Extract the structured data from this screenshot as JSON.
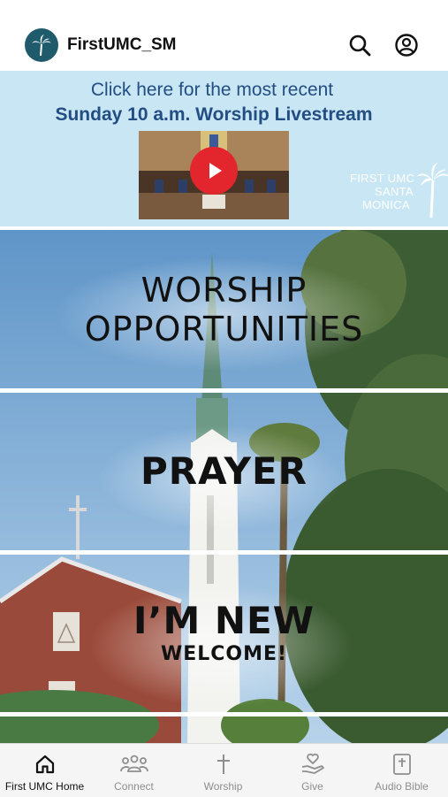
{
  "header": {
    "app_title": "FirstUMC_SM",
    "search_icon": "search-icon",
    "profile_icon": "account-circle-icon"
  },
  "banner": {
    "line1": "Click here for the most recent",
    "line2": "Sunday 10 a.m. Worship Livestream",
    "video_icon": "play-icon",
    "brand_line1": "FIRST UMC",
    "brand_line2": "SANTA",
    "brand_line3": "MONICA",
    "bg_color": "#c9e6f4",
    "text_color": "#234e84",
    "play_color": "#e3262e"
  },
  "tiles": [
    {
      "title": "WORSHIP",
      "title2": "OPPORTUNITIES"
    },
    {
      "title": "PRAYER"
    },
    {
      "title": "I’M NEW",
      "subtitle": "WELCOME!"
    }
  ],
  "nav": {
    "active_color": "#111111",
    "inactive_color": "#8e8e8e",
    "items": [
      {
        "label": "First UMC Home",
        "icon": "home-icon",
        "active": true
      },
      {
        "label": "Connect",
        "icon": "group-icon",
        "active": false
      },
      {
        "label": "Worship",
        "icon": "cross-icon",
        "active": false
      },
      {
        "label": "Give",
        "icon": "give-hand-icon",
        "active": false
      },
      {
        "label": "Audio Bible",
        "icon": "bible-icon",
        "active": false
      }
    ]
  }
}
